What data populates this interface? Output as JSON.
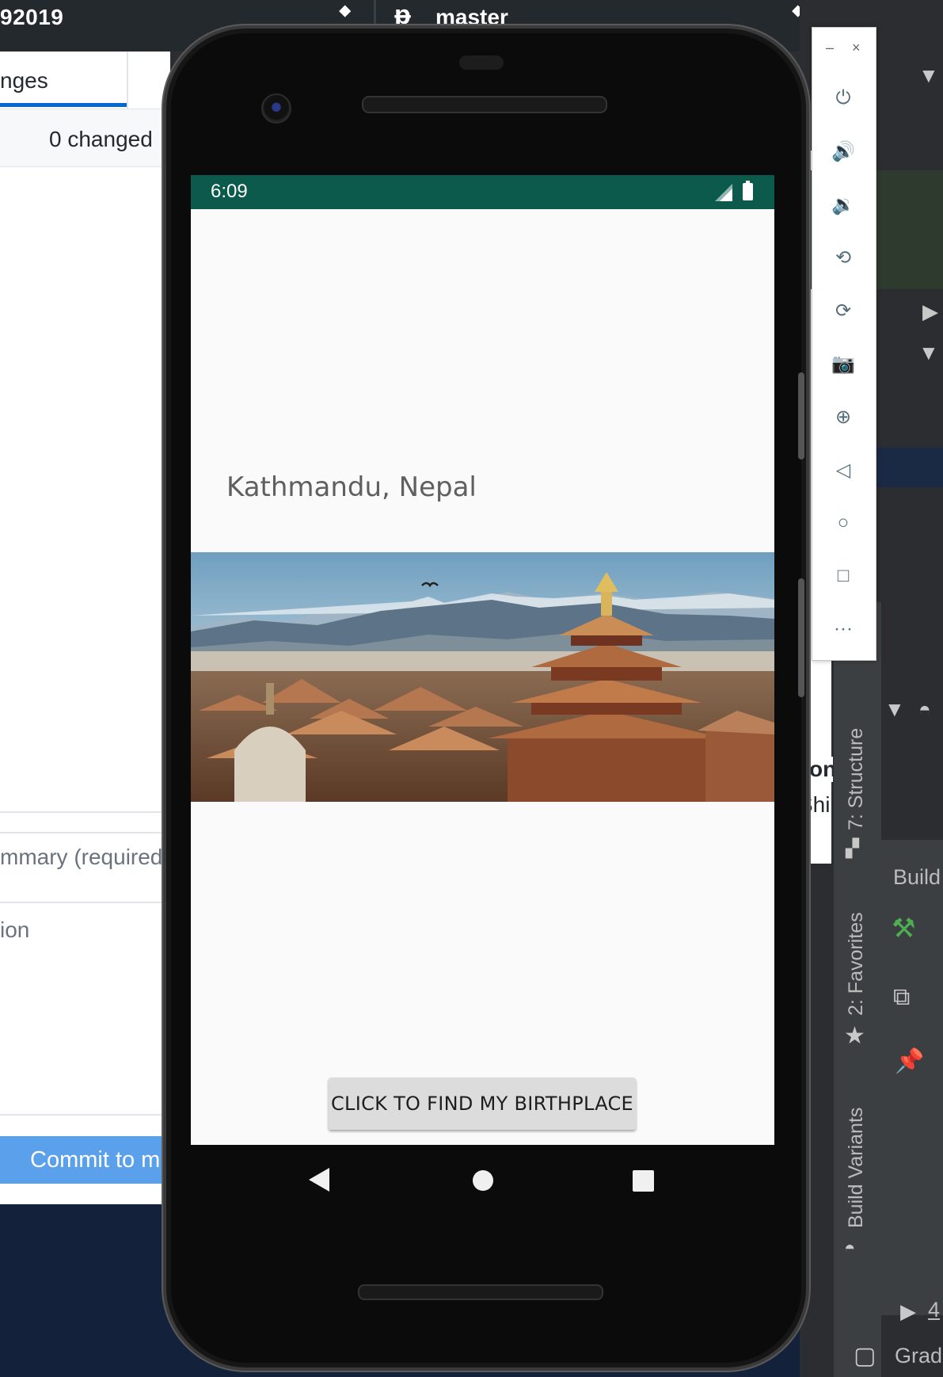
{
  "github_desktop": {
    "repo_name": "92019",
    "branch_icon": "ᵽ",
    "branch_name": "master",
    "caret": "⬥",
    "tab_changes": "nges",
    "changed_count": "0 changed",
    "summary_placeholder": "mmary (required",
    "description_placeholder": "ion",
    "commit_button": "Commit to m"
  },
  "android_studio": {
    "tool_windows": {
      "structure": "7: Structure",
      "favorites": "2: Favorites",
      "build_variants": "Build Variants"
    },
    "build_label": "Build",
    "gradle_label": "Grad",
    "run_label": "4",
    "peek_text_on": "on",
    "peek_text_shi": "Shi"
  },
  "emulator_toolbar": {
    "minimize": "–",
    "close": "×",
    "tools": [
      {
        "icon": "power-icon",
        "glyph": "⏻"
      },
      {
        "icon": "volume-up-icon",
        "glyph": "🔊"
      },
      {
        "icon": "volume-down-icon",
        "glyph": "🔉"
      },
      {
        "icon": "rotate-left-icon",
        "glyph": "⟲"
      },
      {
        "icon": "rotate-right-icon",
        "glyph": "⟳"
      },
      {
        "icon": "camera-icon",
        "glyph": "📷"
      },
      {
        "icon": "zoom-icon",
        "glyph": "⊕"
      },
      {
        "icon": "back-icon",
        "glyph": "◁"
      },
      {
        "icon": "home-icon",
        "glyph": "○"
      },
      {
        "icon": "overview-icon",
        "glyph": "□"
      },
      {
        "icon": "more-icon",
        "glyph": "···"
      }
    ]
  },
  "phone": {
    "status_time": "6:09",
    "status_bar_color": "#0b5a4c",
    "city_text": "Kathmandu, Nepal",
    "photo_description": "temple-rooftops-mountains-icon",
    "button_label": "CLICK TO FIND MY BIRTHPLACE"
  }
}
